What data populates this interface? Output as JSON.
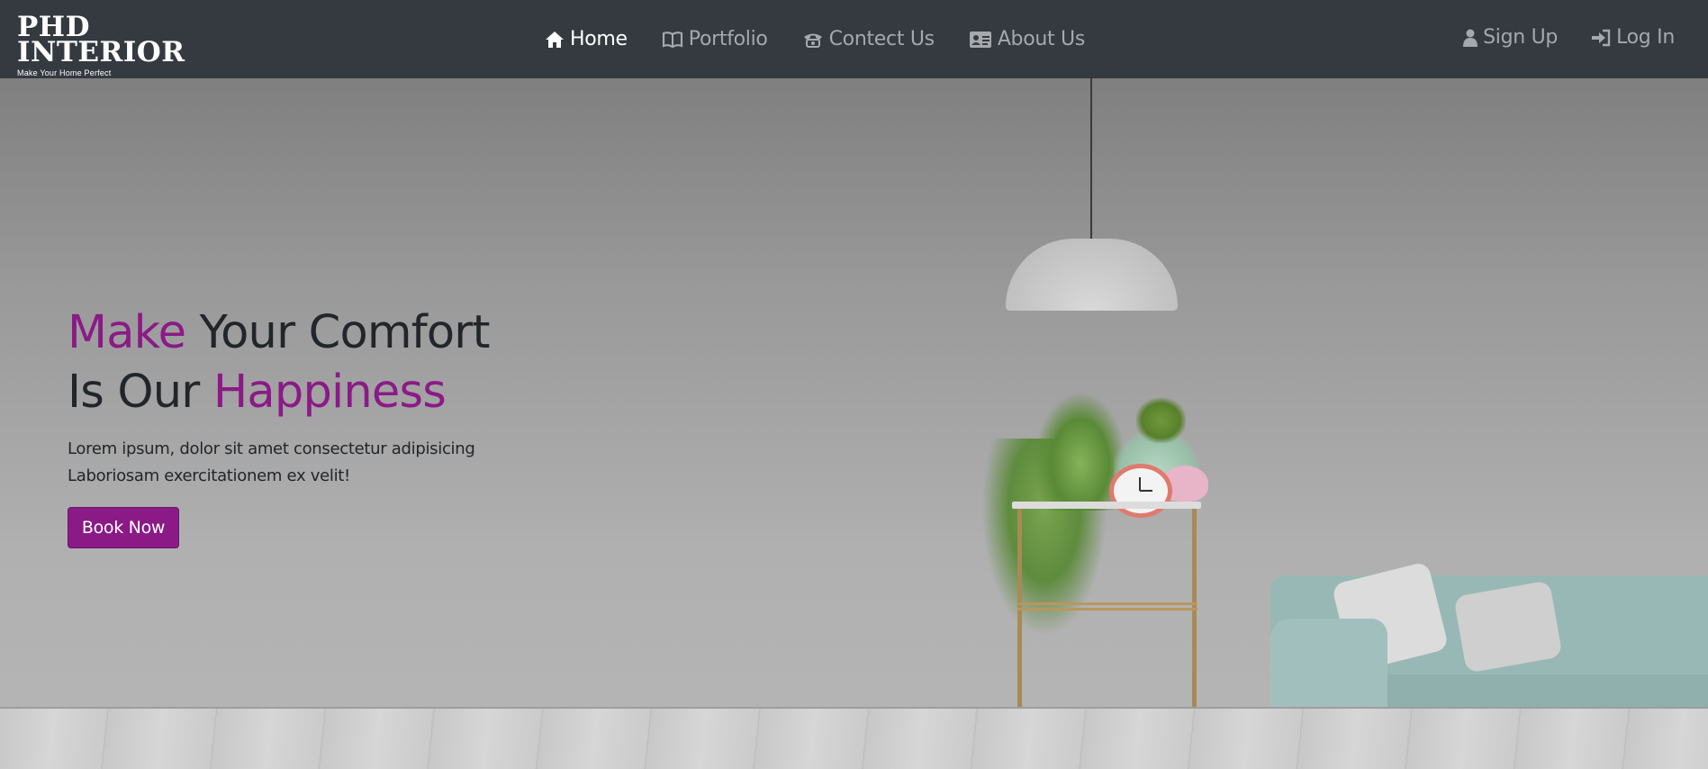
{
  "brand": {
    "line1": "PHD",
    "line2": "INTERIOR",
    "tagline": "Make Your Home Perfect"
  },
  "nav": {
    "items": [
      {
        "label": "Home",
        "icon": "home-icon",
        "active": true
      },
      {
        "label": "Portfolio",
        "icon": "book-icon",
        "active": false
      },
      {
        "label": "Contect Us",
        "icon": "phone-icon",
        "active": false
      },
      {
        "label": "About Us",
        "icon": "id-card-icon",
        "active": false
      }
    ],
    "auth": [
      {
        "label": "Sign Up",
        "icon": "user-icon"
      },
      {
        "label": "Log In",
        "icon": "sign-in-icon"
      }
    ]
  },
  "hero": {
    "headline_part1": "Make",
    "headline_part2": " Your Comfort",
    "headline_part3": "Is Our ",
    "headline_part4": "Happiness",
    "description_line1": "Lorem ipsum, dolor sit amet consectetur adipisicing",
    "description_line2": "Laboriosam exercitationem ex velit!",
    "cta_label": "Book Now",
    "background_subject": "living-room-with-lamp-plants-and-sofa"
  },
  "colors": {
    "navbar": "#343a40",
    "accent": "#8b1a87",
    "nav_text": "#a5a8ac",
    "nav_active": "#ffffff",
    "headline": "#222529"
  }
}
